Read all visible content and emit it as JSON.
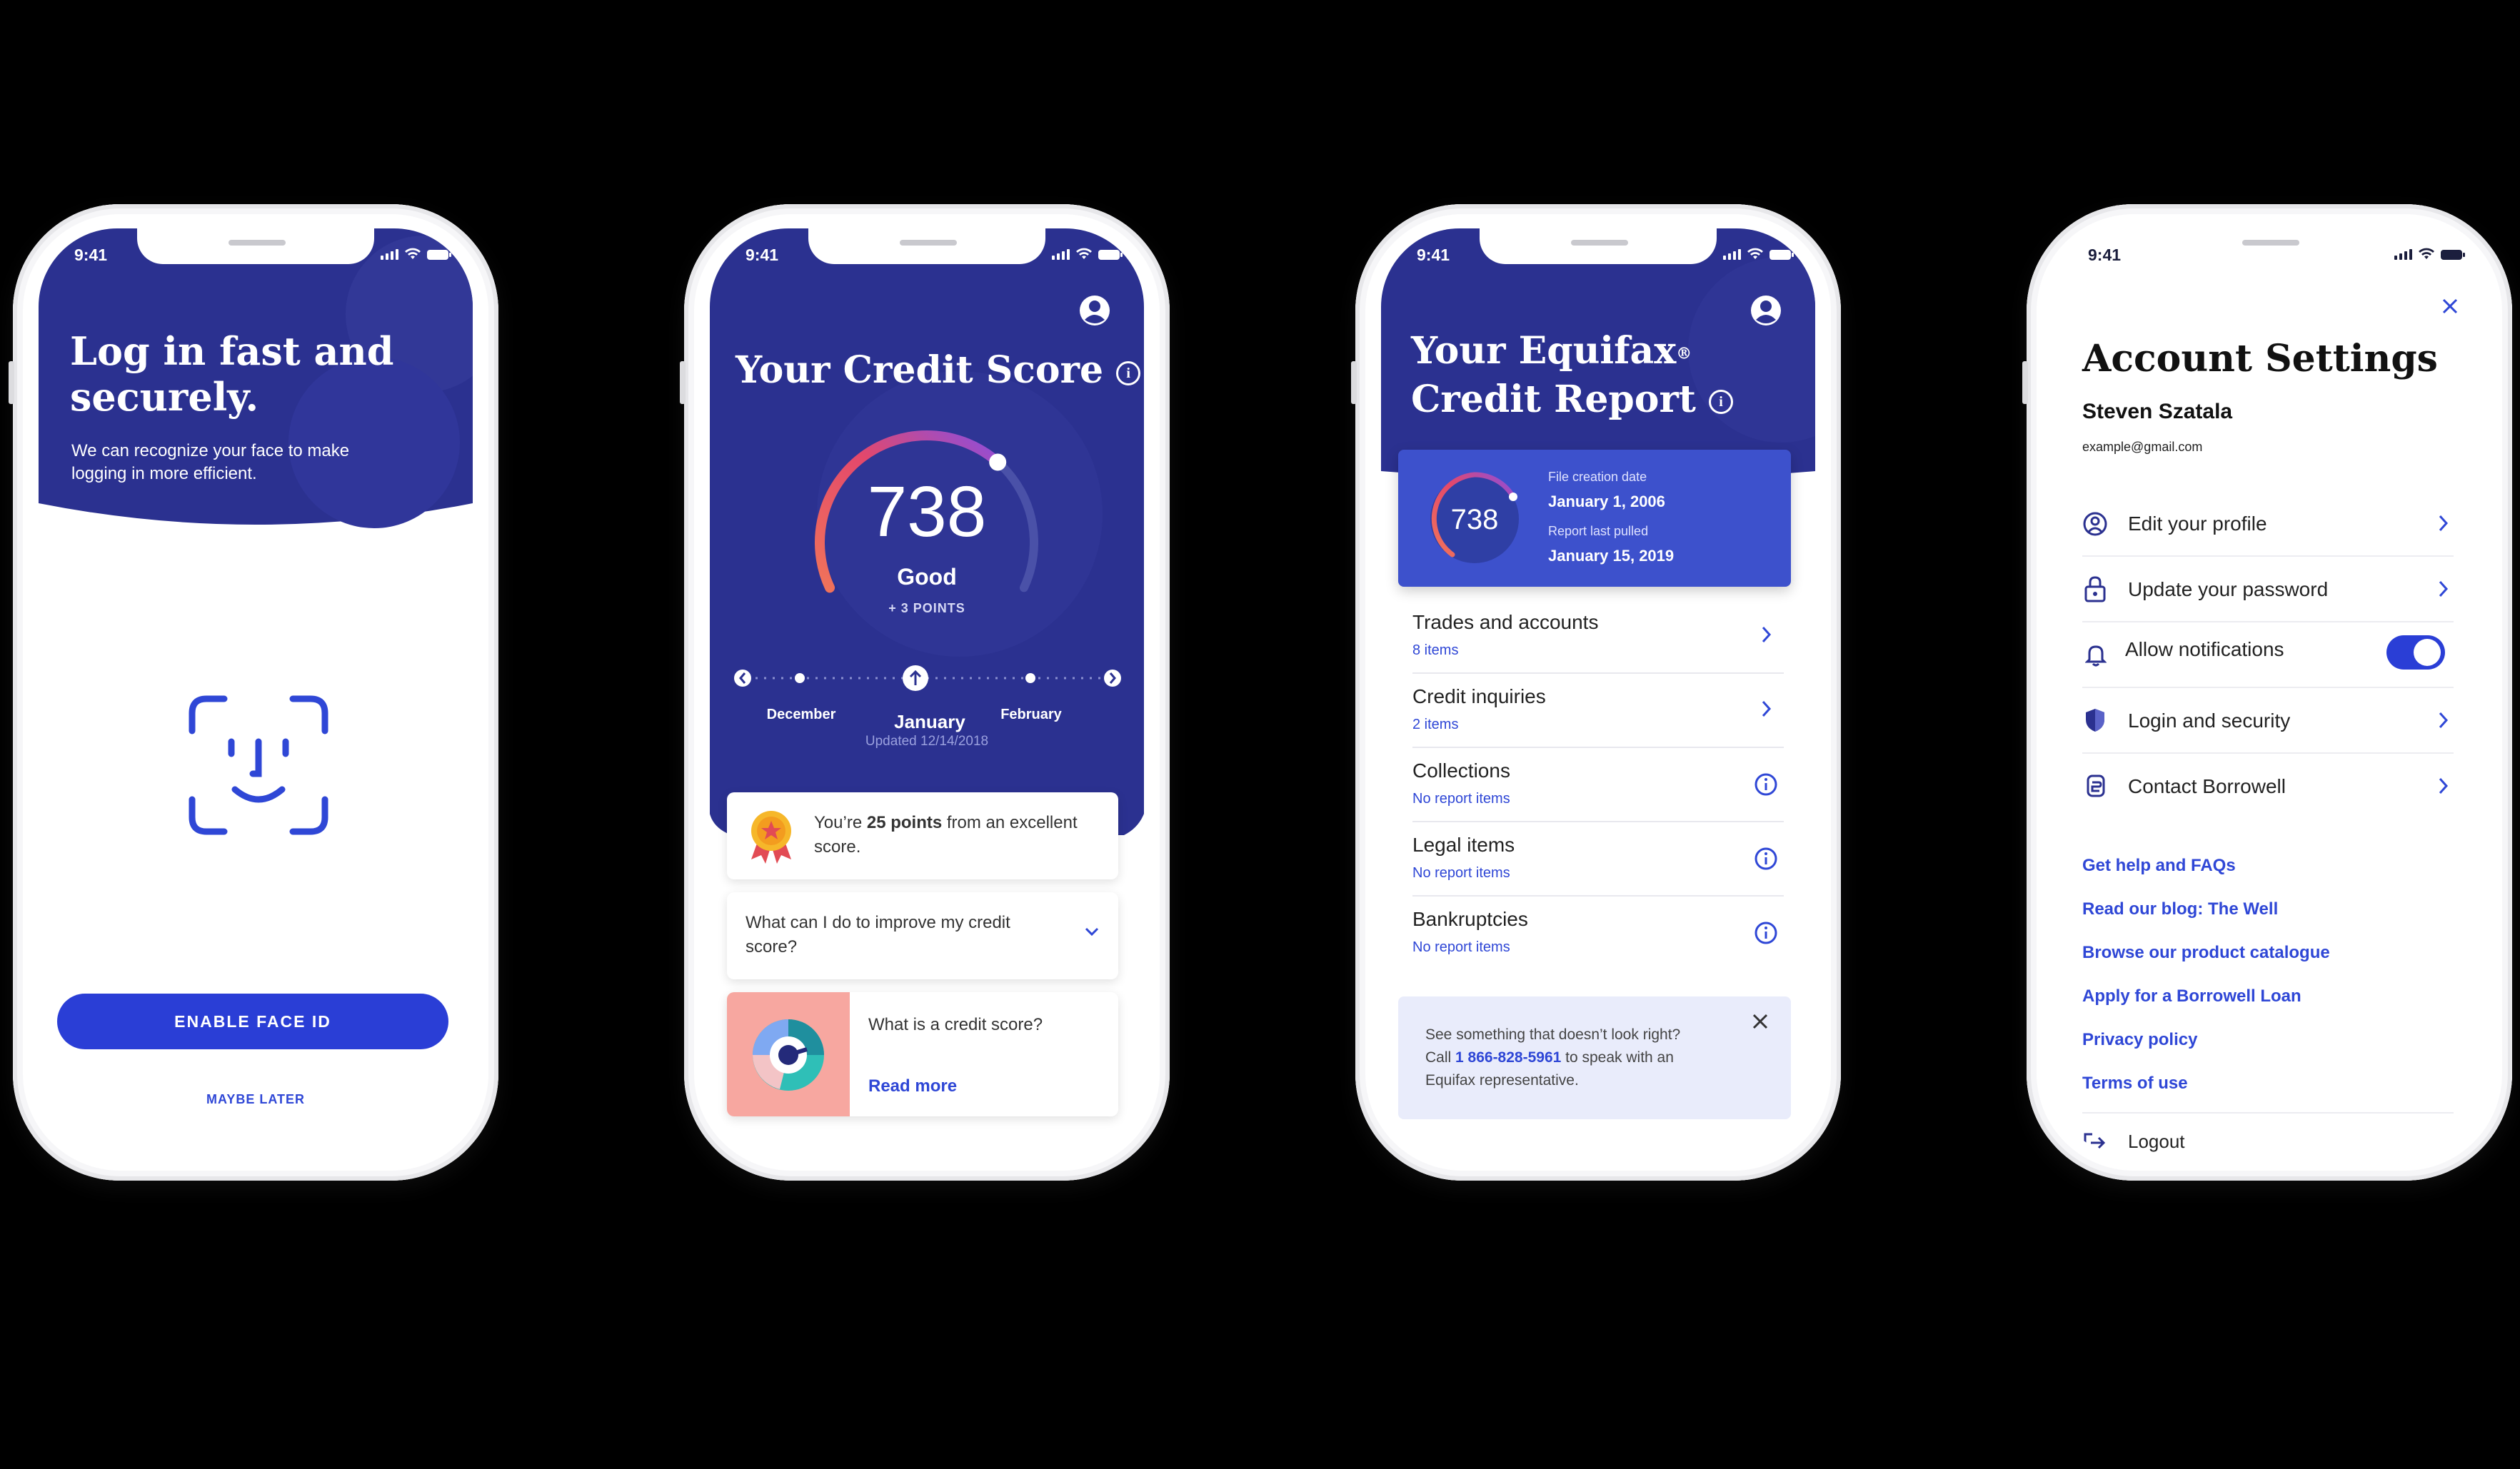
{
  "status_time": "9:41",
  "phone1": {
    "title_line1": "Log in fast and",
    "title_line2": "securely.",
    "subtitle_line1": "We can recognize your face to make",
    "subtitle_line2": "logging in more efficient.",
    "face_id_icon": "face-id-icon",
    "enable_button": "ENABLE FACE ID",
    "later_link": "MAYBE LATER"
  },
  "phone2": {
    "title": "Your Credit Score",
    "score": "738",
    "score_label": "Good",
    "points_change": "+ 3 POINTS",
    "timeline": {
      "prev": "December",
      "current": "January",
      "next": "February",
      "updated": "Updated 12/14/2018"
    },
    "gauge_fraction": 0.68,
    "tip_prefix": "You’re ",
    "tip_bold": "25 points",
    "tip_suffix_line1": " from an excellent",
    "tip_suffix_line2": "score.",
    "faq_line1": "What can I do to improve my credit",
    "faq_line2": "score?",
    "article_title": "What is a credit score?",
    "article_link": "Read more"
  },
  "phone3": {
    "title_line1": "Your Equifax",
    "registered": "®",
    "title_line2": "Credit Report",
    "score": "738",
    "file_creation_label": "File creation date",
    "file_creation_value": "January 1, 2006",
    "last_pulled_label": "Report last pulled",
    "last_pulled_value": "January 15, 2019",
    "items": [
      {
        "title": "Trades and accounts",
        "sub": "8 items",
        "action": "chevron"
      },
      {
        "title": "Credit inquiries",
        "sub": "2 items",
        "action": "chevron"
      },
      {
        "title": "Collections",
        "sub": "No report items",
        "action": "info"
      },
      {
        "title": "Legal items",
        "sub": "No report items",
        "action": "info"
      },
      {
        "title": "Bankruptcies",
        "sub": "No report items",
        "action": "info"
      }
    ],
    "notice_line1": "See something that doesn’t look right?",
    "notice_call": "Call ",
    "notice_phone": "1 866-828-5961",
    "notice_after_phone": " to speak with an",
    "notice_line3": "Equifax representative."
  },
  "phone4": {
    "title": "Account Settings",
    "name": "Steven Szatala",
    "email": "example@gmail.com",
    "menu": [
      {
        "label": "Edit your profile",
        "icon": "user-circle-icon"
      },
      {
        "label": "Update your password",
        "icon": "lock-icon"
      },
      {
        "label": "Allow notifications",
        "icon": "bell-icon",
        "toggle": true
      },
      {
        "label": "Login and security",
        "icon": "shield-icon"
      },
      {
        "label": "Contact Borrowell",
        "icon": "contact-icon"
      }
    ],
    "links": [
      "Get help and FAQs",
      "Read our blog: The Well",
      "Browse our product catalogue",
      "Apply for a Borrowell Loan",
      "Privacy policy",
      "Terms of use"
    ],
    "logout": "Logout"
  }
}
